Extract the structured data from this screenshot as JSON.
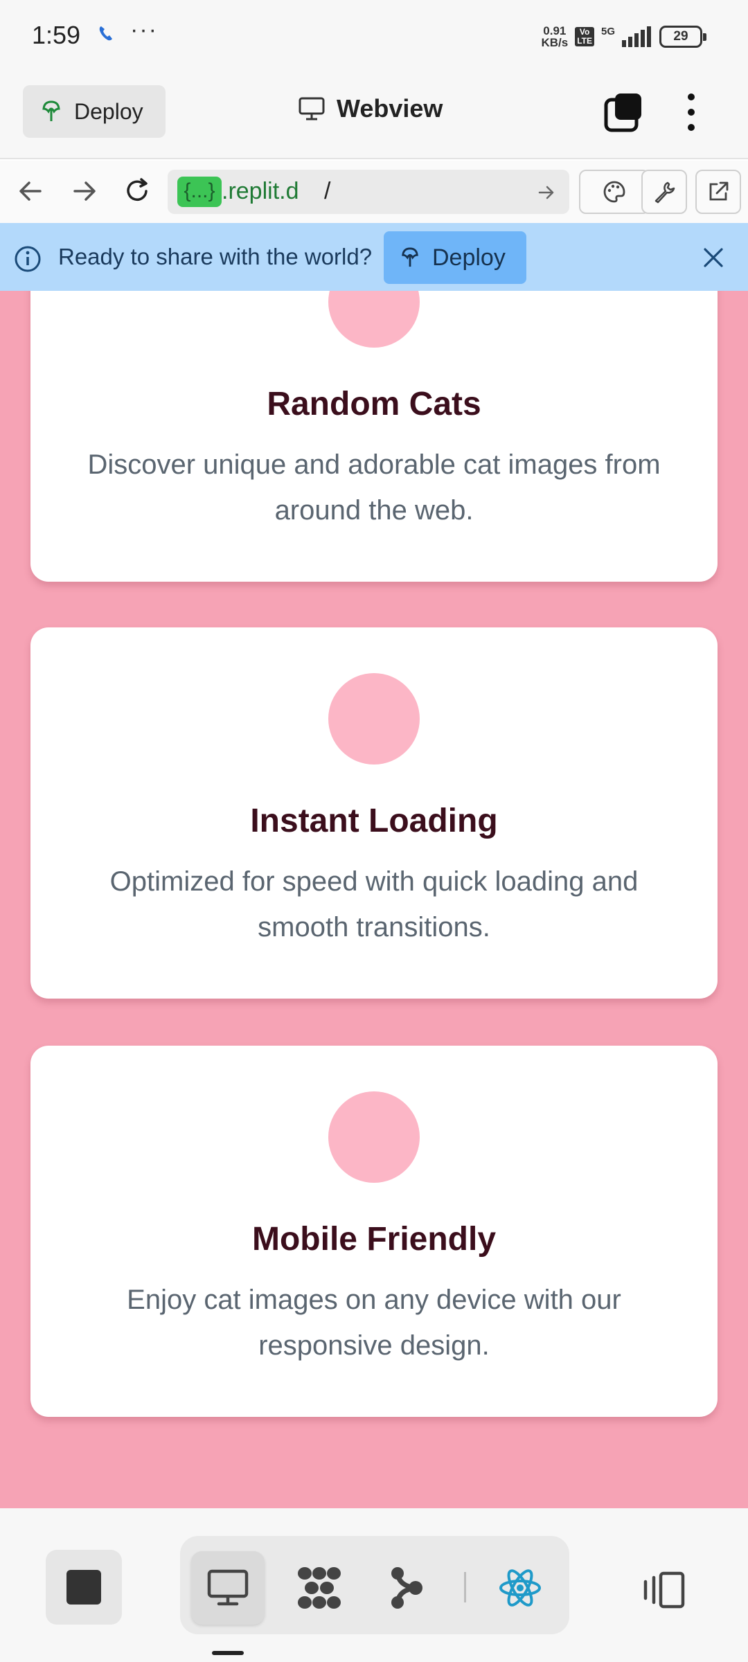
{
  "status_bar": {
    "time": "1:59",
    "dots": "···",
    "net_speed_value": "0.91",
    "net_speed_unit": "KB/s",
    "volte_top": "Vo",
    "volte_bottom": "LTE",
    "network": "5G",
    "battery": "29"
  },
  "app_bar": {
    "deploy_label": "Deploy",
    "title": "Webview"
  },
  "url_bar": {
    "chip": "{...}",
    "domain": ".replit.d",
    "path": "/"
  },
  "banner": {
    "message": "Ready to share with the world?",
    "deploy_label": "Deploy",
    "color": "#b3d9fb"
  },
  "content": {
    "background": "#f6a3b5",
    "cards": [
      {
        "title": "Random Cats",
        "description": "Discover unique and adorable cat images from around the web."
      },
      {
        "title": "Instant Loading",
        "description": "Optimized for speed with quick loading and smooth transitions."
      },
      {
        "title": "Mobile Friendly",
        "description": "Enjoy cat images on any device with our responsive design."
      }
    ]
  },
  "bottom_bar": {
    "icons": [
      "stop-icon",
      "webview-icon",
      "packages-icon",
      "git-icon",
      "react-icon",
      "device-rotate-icon"
    ],
    "accent": "#1f9ac9"
  }
}
